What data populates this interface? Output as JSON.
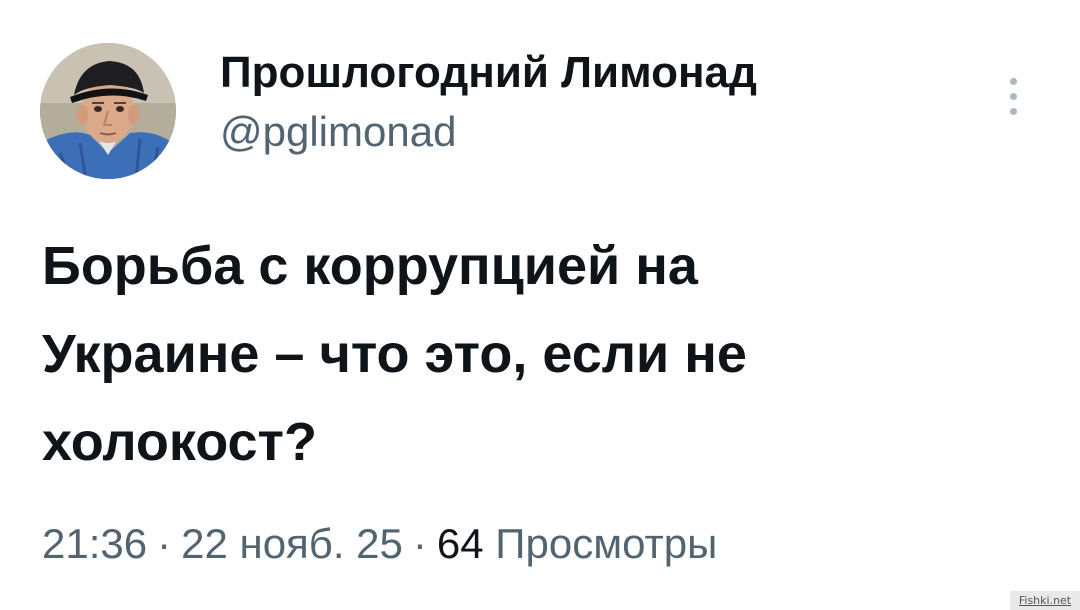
{
  "author": {
    "display_name": "Прошлогодний Лимонад",
    "handle": "@pglimonad",
    "avatar_icon": "user-avatar-photo"
  },
  "tweet": {
    "lines": [
      "Борьба с коррупцией на",
      "Украине – что это, если не",
      "холокост?"
    ]
  },
  "meta": {
    "time": "21:36",
    "separator": "·",
    "date": "22 нояб. 25",
    "views_count": "64",
    "views_label": "Просмотры"
  },
  "watermark": {
    "text": "Fishki.net"
  },
  "colors": {
    "text_primary": "#0f1419",
    "text_secondary": "#536471",
    "more_icon": "#aab8c2"
  }
}
